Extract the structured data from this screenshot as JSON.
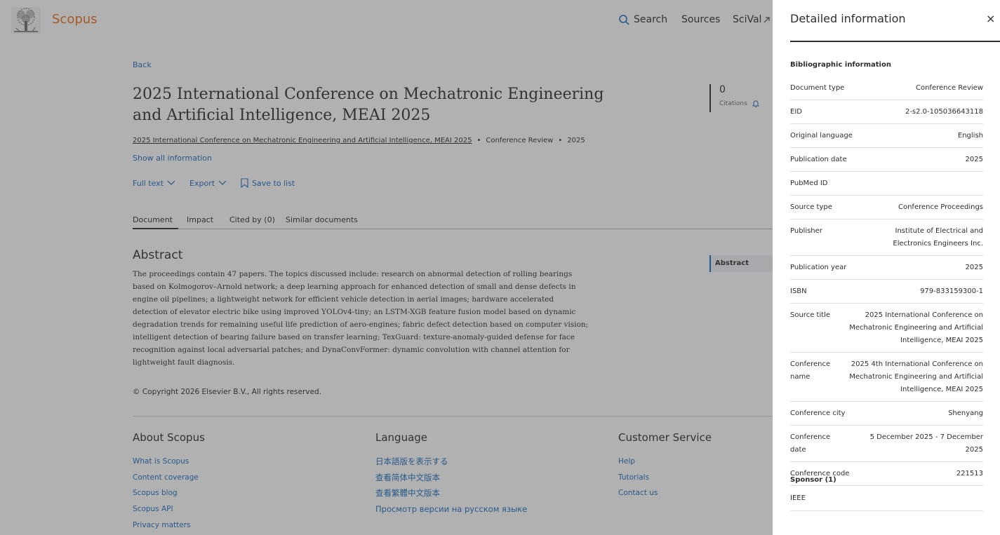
{
  "header": {
    "brand": "Scopus",
    "nav": {
      "search": "Search",
      "sources": "Sources",
      "scival": "SciVal"
    }
  },
  "document": {
    "back_label": "Back",
    "title": "2025 International Conference on Mechatronic Engineering and Artificial Intelligence, MEAI 2025",
    "citations_count": "0",
    "citations_label": "Citations",
    "source_link": "2025 International Conference on Mechatronic Engineering and Artificial Intelligence, MEAI 2025",
    "doc_type": "Conference Review",
    "year": "2025",
    "show_all_info": "Show all information",
    "actions": {
      "full_text": "Full text",
      "export": "Export",
      "save_to_list": "Save to list"
    },
    "tabs": [
      "Document",
      "Impact",
      "Cited by (0)",
      "Similar documents"
    ],
    "abstract_heading": "Abstract",
    "abstract_text": "The proceedings contain 47 papers. The topics discussed include: research on abnormal detection of rolling bearings based on Kolmogorov–Arnold network; a deep learning approach for enhanced detection of small and dense defects in engine oil pipelines; a lightweight network for efficient vehicle detection in aerial images; hardware accelerated detection of elevator electric bike using improved YOLOv4-tiny; an LSTM-XGB feature fusion model based on dynamic degradation trends for remaining useful life prediction of aero-engines; fabric defect detection based on computer vision; intelligent detection of bearing failure based on transfer learning; TexGuard: texture-anomaly-guided defense for face recognition against local adversarial patches; and DynaConvFormer: dynamic convolution with channel attention for lightweight fault diagnosis.",
    "toc_abstract": "Abstract",
    "copyright": "© Copyright 2026 Elsevier B.V., All rights reserved."
  },
  "footer": {
    "about": {
      "heading": "About Scopus",
      "links": [
        "What is Scopus",
        "Content coverage",
        "Scopus blog",
        "Scopus API",
        "Privacy matters"
      ]
    },
    "language": {
      "heading": "Language",
      "links": [
        "日本語版を表示する",
        "查看简体中文版本",
        "查看繁體中文版本",
        "Просмотр версии на русском языке"
      ]
    },
    "customer": {
      "heading": "Customer Service",
      "links": [
        "Help",
        "Tutorials",
        "Contact us"
      ]
    }
  },
  "panel": {
    "title": "Detailed information",
    "close": "×",
    "bib_heading": "Bibliographic information",
    "rows": [
      {
        "label": "Document type",
        "value": "Conference Review"
      },
      {
        "label": "EID",
        "value": "2-s2.0-105036643118"
      },
      {
        "label": "Original language",
        "value": "English"
      },
      {
        "label": "Publication date",
        "value": "2025"
      },
      {
        "label": "PubMed ID",
        "value": ""
      },
      {
        "label": "Source type",
        "value": "Conference Proceedings"
      },
      {
        "label": "Publisher",
        "value": "Institute of Electrical and Electronics Engineers Inc."
      },
      {
        "label": "Publication year",
        "value": "2025"
      },
      {
        "label": "ISBN",
        "value": "979-833159300-1"
      },
      {
        "label": "Source title",
        "value": "2025 International Conference on Mechatronic Engineering and Artificial Intelligence, MEAI 2025"
      },
      {
        "label": "Conference name",
        "value": "2025 4th International Conference on Mechatronic Engineering and Artificial Intelligence, MEAI 2025"
      },
      {
        "label": "Conference city",
        "value": "Shenyang"
      },
      {
        "label": "Conference date",
        "value": "5 December 2025 - 7 December 2025"
      },
      {
        "label": "Conference code",
        "value": "221513"
      }
    ],
    "sponsor_heading": "Sponsor (1)",
    "sponsor": "IEEE"
  }
}
